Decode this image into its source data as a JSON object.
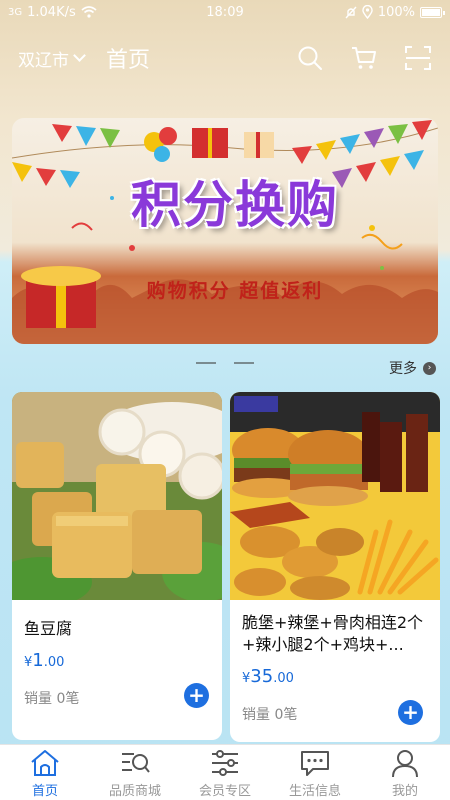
{
  "status_bar": {
    "signal": "3G",
    "speed": "1.04K/s",
    "time": "18:09",
    "battery": "100%"
  },
  "header": {
    "city": "双辽市",
    "title": "首页",
    "icons": [
      "search-icon",
      "cart-icon",
      "scan-icon"
    ]
  },
  "banner": {
    "title": "积分换购",
    "subtitle": "购物积分  超值返利"
  },
  "more_label": "更多",
  "products": [
    {
      "name": "鱼豆腐",
      "price_symbol": "¥",
      "price_int": "1",
      "price_dec": ".00",
      "sales": "销量 0笔"
    },
    {
      "name": "脆堡+辣堡+骨肉相连2个+辣小腿2个+鸡块+...",
      "price_symbol": "¥",
      "price_int": "35",
      "price_dec": ".00",
      "sales": "销量 0笔"
    }
  ],
  "bottom_nav": [
    {
      "label": "首页",
      "icon": "home-icon",
      "active": true
    },
    {
      "label": "品质商城",
      "icon": "mall-icon",
      "active": false
    },
    {
      "label": "会员专区",
      "icon": "member-icon",
      "active": false
    },
    {
      "label": "生活信息",
      "icon": "message-icon",
      "active": false
    },
    {
      "label": "我的",
      "icon": "user-icon",
      "active": false
    }
  ],
  "colors": {
    "accent": "#1e6fe0",
    "price": "#1769d8"
  }
}
